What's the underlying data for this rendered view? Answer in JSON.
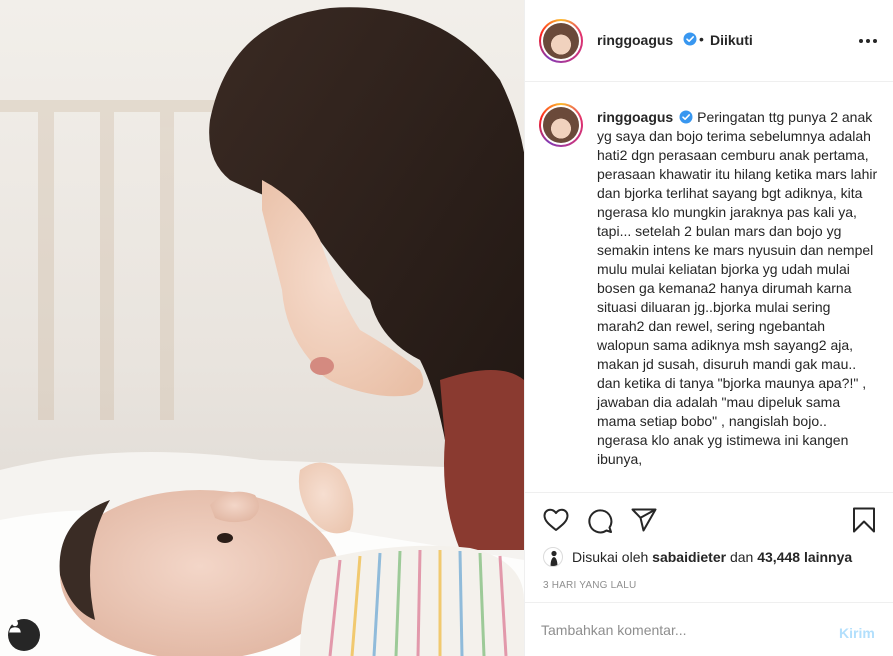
{
  "post": {
    "photo_description_icon": "user-tag-icon"
  },
  "header": {
    "username": "ringgoagus",
    "separator": "•",
    "follow_status": "Diikuti",
    "more_icon": "more-options-icon"
  },
  "caption": {
    "username": "ringgoagus",
    "text": "Peringatan ttg punya 2 anak yg saya dan bojo terima sebelumnya adalah hati2 dgn perasaan cemburu anak pertama, perasaan khawatir itu hilang ketika mars lahir dan bjorka terlihat sayang bgt adiknya, kita ngerasa klo mungkin jaraknya pas kali ya, tapi... setelah 2 bulan mars dan bojo yg semakin intens ke mars nyusuin dan nempel mulu mulai keliatan bjorka yg udah mulai bosen ga kemana2 hanya dirumah karna situasi diluaran jg..bjorka mulai sering marah2 dan rewel, sering ngebantah walopun sama adiknya msh sayang2 aja, makan jd susah, disuruh mandi gak mau.. dan ketika di tanya \"bjorka maunya apa?!\" , jawaban dia adalah \"mau dipeluk sama mama setiap bobo\" , nangislah bojo.. ngerasa klo anak yg istimewa ini kangen ibunya,"
  },
  "actions": {
    "icons": [
      "heart-icon",
      "comment-icon",
      "share-icon",
      "bookmark-icon"
    ]
  },
  "likes": {
    "prefix": "Disukai oleh",
    "user": "sabaidieter",
    "connector": "dan",
    "count": "43,448 lainnya"
  },
  "timestamp": "3 HARI YANG LALU",
  "comment": {
    "placeholder": "Tambahkan komentar...",
    "post_label": "Kirim"
  },
  "colors": {
    "verified": "#3897f0",
    "post_button_disabled": "#b2dffc",
    "muted": "#8e8e8e",
    "text": "#262626"
  }
}
